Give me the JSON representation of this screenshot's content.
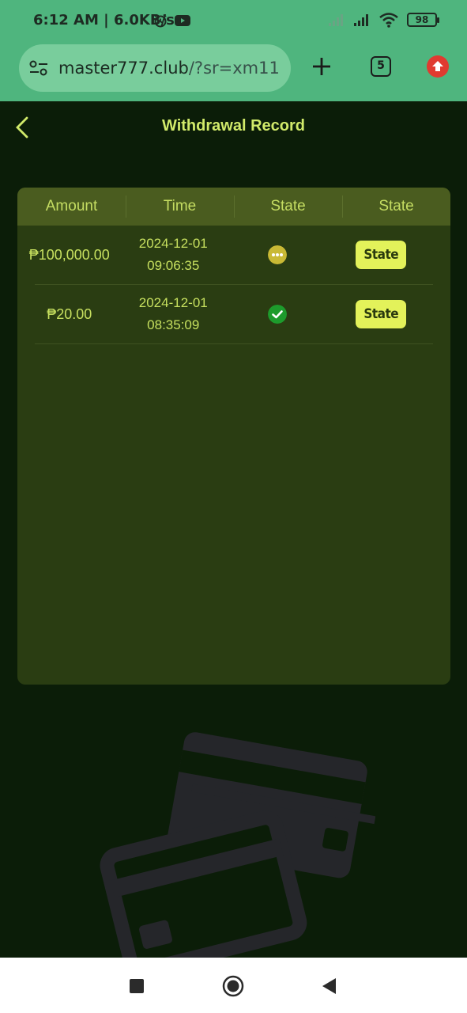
{
  "status_bar": {
    "time": "6:12 AM | 6.0KB/s",
    "battery": "98"
  },
  "browser": {
    "url_host": "master777.club",
    "url_path": "/?sr=xm11",
    "tab_count": "5"
  },
  "header": {
    "title": "Withdrawal Record"
  },
  "table": {
    "columns": [
      "Amount",
      "Time",
      "State",
      "State"
    ],
    "rows": [
      {
        "amount": "₱100,000.00",
        "date": "2024-12-01",
        "time": "09:06:35",
        "status": "pending",
        "button": "State"
      },
      {
        "amount": "₱20.00",
        "date": "2024-12-01",
        "time": "08:35:09",
        "status": "success",
        "button": "State"
      }
    ]
  },
  "colors": {
    "accent": "#d1ea6a",
    "background": "#0b1d08",
    "card": "#2a3d12",
    "header_row": "#4a5c1f",
    "pending": "#c9b935",
    "success": "#1d9b2c",
    "browser_bar": "#4fb57e"
  }
}
